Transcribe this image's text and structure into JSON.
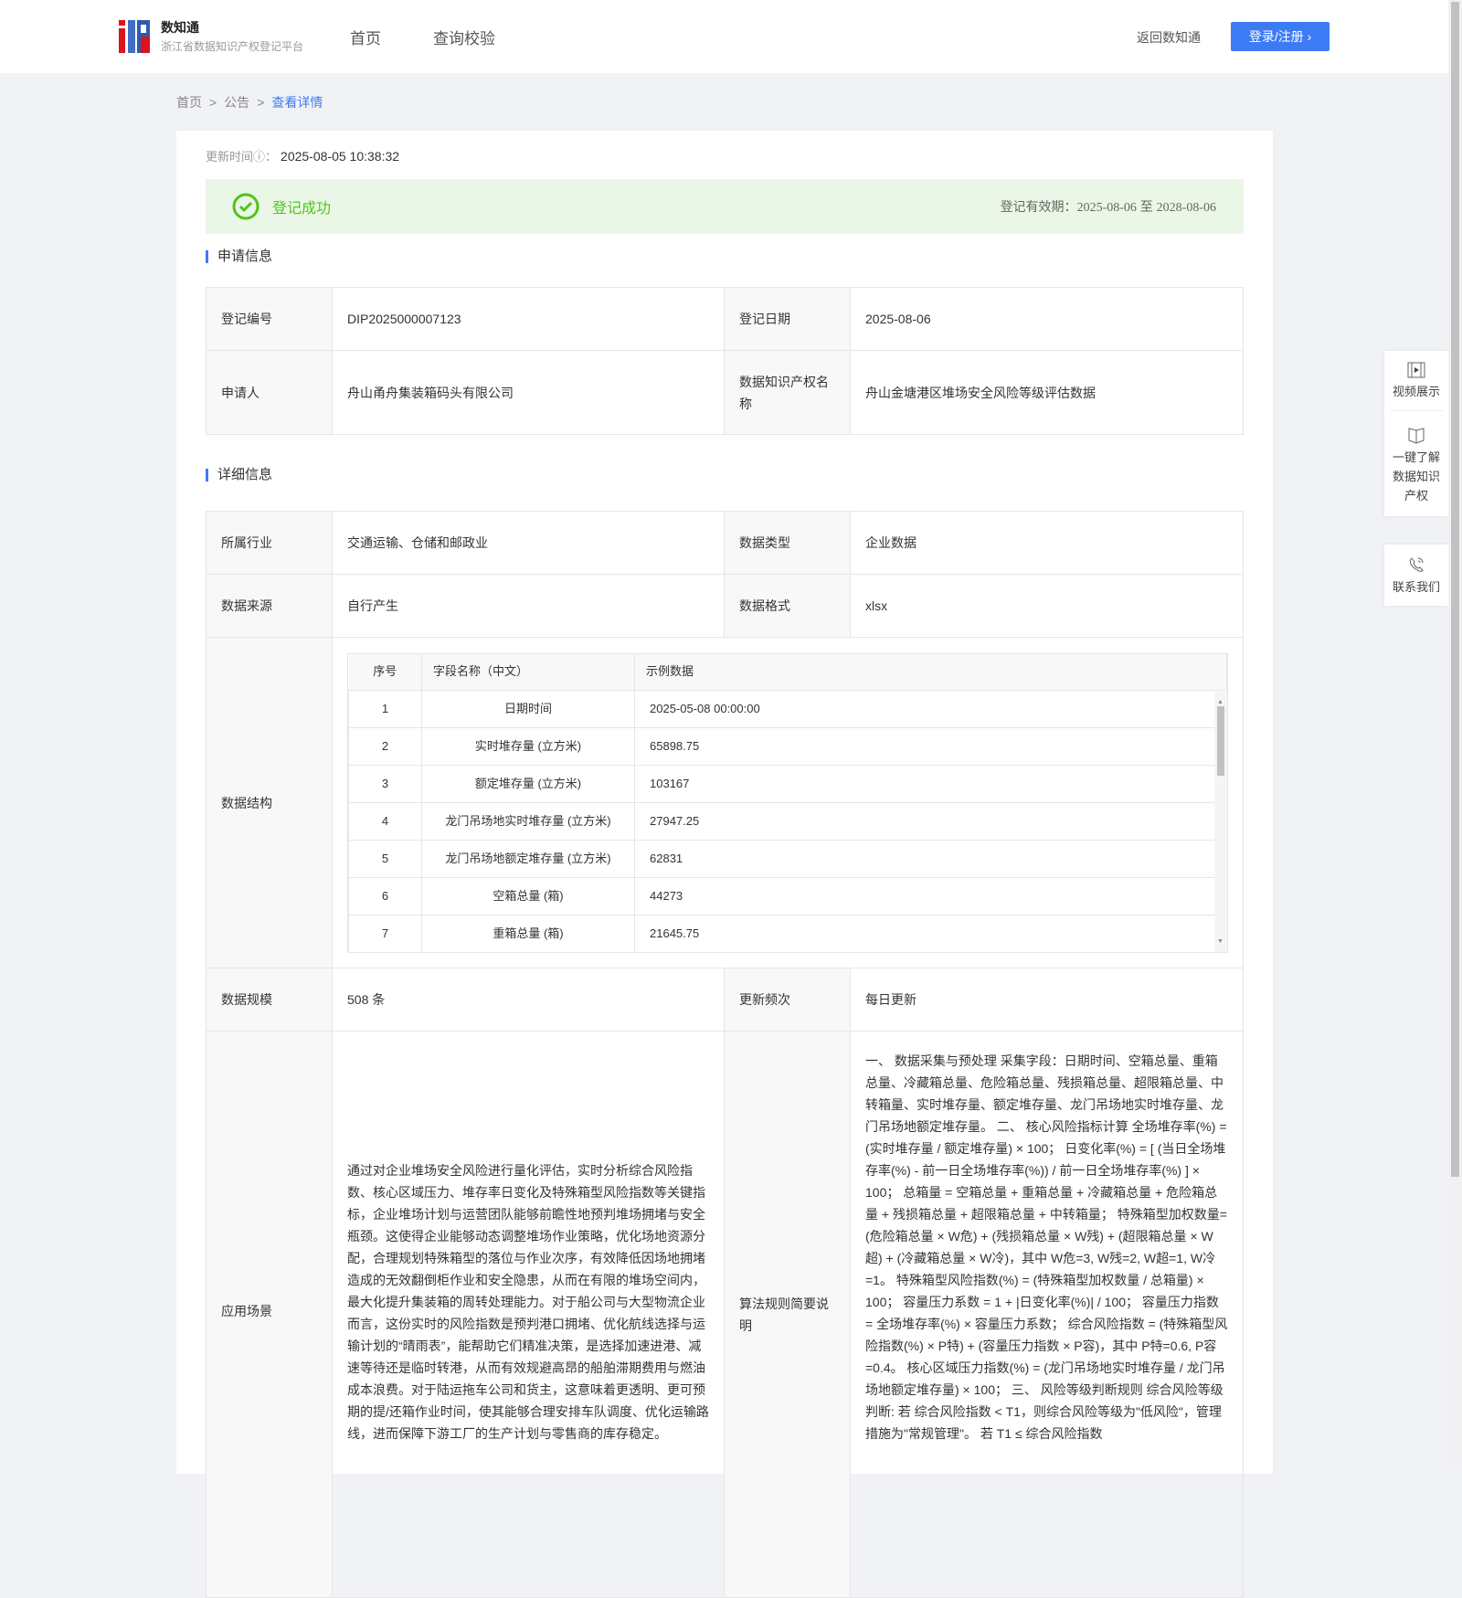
{
  "header": {
    "brand": "数知通",
    "subtitle": "浙江省数据知识产权登记平台",
    "nav": [
      "首页",
      "查询校验"
    ],
    "back": "返回数知通",
    "login": "登录/注册"
  },
  "breadcrumb": [
    "首页",
    "公告",
    "查看详情"
  ],
  "update": {
    "label": "更新时间",
    "value": "2025-08-05 10:38:32"
  },
  "status": {
    "text": "登记成功",
    "valid_label": "登记有效期：",
    "valid_from": "2025-08-06",
    "valid_to_sep": "至",
    "valid_to": "2028-08-06",
    "color": "#52c41a"
  },
  "apply": {
    "title": "申请信息",
    "reg_no_label": "登记编号",
    "reg_no": "DIP2025000007123",
    "reg_date_label": "登记日期",
    "reg_date": "2025-08-06",
    "applicant_label": "申请人",
    "applicant": "舟山甬舟集装箱码头有限公司",
    "name_label": "数据知识产权名称",
    "name": "舟山金塘港区堆场安全风险等级评估数据"
  },
  "detail": {
    "title": "详细信息",
    "industry_label": "所属行业",
    "industry": "交通运输、仓储和邮政业",
    "type_label": "数据类型",
    "type": "企业数据",
    "source_label": "数据来源",
    "source": "自行产生",
    "format_label": "数据格式",
    "format": "xlsx",
    "structure_label": "数据结构",
    "structure": {
      "headers": [
        "序号",
        "字段名称（中文）",
        "示例数据"
      ],
      "rows": [
        [
          "1",
          "日期时间",
          "2025-05-08 00:00:00"
        ],
        [
          "2",
          "实时堆存量 (立方米)",
          "65898.75"
        ],
        [
          "3",
          "额定堆存量 (立方米)",
          "103167"
        ],
        [
          "4",
          "龙门吊场地实时堆存量 (立方米)",
          "27947.25"
        ],
        [
          "5",
          "龙门吊场地额定堆存量 (立方米)",
          "62831"
        ],
        [
          "6",
          "空箱总量 (箱)",
          "44273"
        ],
        [
          "7",
          "重箱总量 (箱)",
          "21645.75"
        ]
      ]
    },
    "scale_label": "数据规模",
    "scale": "508 条",
    "freq_label": "更新频次",
    "freq": "每日更新",
    "scene_label": "应用场景",
    "scene": "通过对企业堆场安全风险进行量化评估，实时分析综合风险指数、核心区域压力、堆存率日变化及特殊箱型风险指数等关键指标，企业堆场计划与运营团队能够前瞻性地预判堆场拥堵与安全瓶颈。这使得企业能够动态调整堆场作业策略，优化场地资源分配，合理规划特殊箱型的落位与作业次序，有效降低因场地拥堵造成的无效翻倒柜作业和安全隐患，从而在有限的堆场空间内，最大化提升集装箱的周转处理能力。对于船公司与大型物流企业而言，这份实时的风险指数是预判港口拥堵、优化航线选择与运输计划的“晴雨表”，能帮助它们精准决策，是选择加速进港、减速等待还是临时转港，从而有效规避高昂的船舶滞期费用与燃油成本浪费。对于陆运拖车公司和货主，这意味着更透明、更可预期的提/还箱作业时间，使其能够合理安排车队调度、优化运输路线，进而保障下游工厂的生产计划与零售商的库存稳定。",
    "algo_label": "算法规则简要说明",
    "algo": "一、 数据采集与预处理 采集字段：日期时间、空箱总量、重箱总量、冷藏箱总量、危险箱总量、残损箱总量、超限箱总量、中转箱量、实时堆存量、额定堆存量、龙门吊场地实时堆存量、龙门吊场地额定堆存量。 二、 核心风险指标计算 全场堆存率(%) = (实时堆存量 / 额定堆存量) × 100； 日变化率(%) = [ (当日全场堆存率(%) - 前一日全场堆存率(%)) / 前一日全场堆存率(%) ] × 100； 总箱量 = 空箱总量 + 重箱总量 + 冷藏箱总量 + 危险箱总量 + 残损箱总量 + 超限箱总量 + 中转箱量； 特殊箱型加权数量= (危险箱总量 × W危) + (残损箱总量 × W残) + (超限箱总量 × W超) + (冷藏箱总量 × W冷)，其中 W危=3, W残=2, W超=1, W冷=1。 特殊箱型风险指数(%) = (特殊箱型加权数量 / 总箱量) × 100； 容量压力系数 = 1 + |日变化率(%)| / 100； 容量压力指数 = 全场堆存率(%) × 容量压力系数； 综合风险指数 = (特殊箱型风险指数(%) × P特) + (容量压力指数 × P容)，其中 P特=0.6, P容=0.4。 核心区域压力指数(%) = (龙门吊场地实时堆存量 / 龙门吊场地额定堆存量) × 100； 三、 风险等级判断规则 综合风险等级判断: 若 综合风险指数 < T1，则综合风险等级为\"低风险\"，管理措施为\"常规管理\"。 若 T1 ≤ 综合风险指数"
  },
  "side": {
    "video": "视频展示",
    "learn": "一键了解数据知识产权",
    "contact": "联系我们"
  }
}
